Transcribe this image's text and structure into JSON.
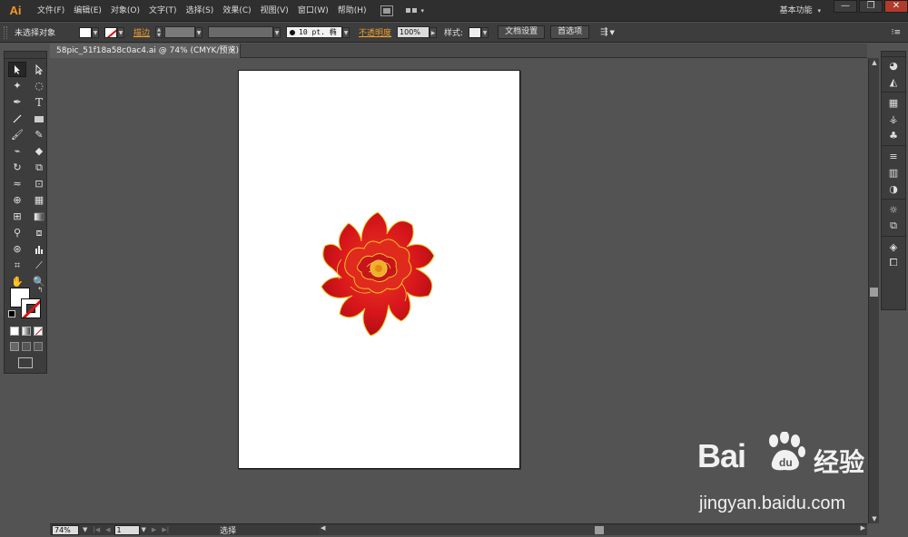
{
  "app": {
    "logo": "Ai"
  },
  "menu": {
    "items": [
      "文件(F)",
      "编辑(E)",
      "对象(O)",
      "文字(T)",
      "选择(S)",
      "效果(C)",
      "视图(V)",
      "窗口(W)",
      "帮助(H)"
    ]
  },
  "workspace": {
    "label": "基本功能",
    "caret": "▾"
  },
  "window_buttons": {
    "minimize": "—",
    "restore": "❐",
    "close": "✕"
  },
  "controlbar": {
    "selection_label": "未选择对象",
    "stroke_label": "描边",
    "stroke_profile": "10 pt. 椭",
    "opacity_label": "不透明度",
    "opacity_value": "100%",
    "style_label": "样式:",
    "doc_setup_button": "文档设置",
    "preferences_button": "首选项"
  },
  "document": {
    "tab_title": "58pic_51f18a58c0ac4.ai @ 74% (CMYK/预览)",
    "close": "×"
  },
  "statusbar": {
    "zoom": "74%",
    "page": "1",
    "status": "选择"
  },
  "watermark": {
    "brand": "Bai",
    "brand_cn": "经验",
    "url": "jingyan.baidu.com"
  },
  "colors": {
    "accent": "#f29a1e",
    "flower_red": "#d7161b",
    "flower_gold": "#f0c020",
    "ui_dark": "#3d3d3d",
    "pasteboard": "#535353"
  },
  "icons": {
    "tools": [
      "selection-tool-icon",
      "direct-selection-tool-icon",
      "magic-wand-icon",
      "lasso-icon",
      "pen-icon",
      "type-icon",
      "line-icon",
      "rectangle-icon",
      "paintbrush-icon",
      "pencil-icon",
      "blob-brush-icon",
      "eraser-icon",
      "rotate-icon",
      "scale-icon",
      "width-icon",
      "free-transform-icon",
      "shape-builder-icon",
      "perspective-grid-icon",
      "mesh-icon",
      "gradient-icon",
      "eyedropper-icon",
      "blend-icon",
      "symbol-sprayer-icon",
      "column-graph-icon",
      "artboard-icon",
      "slice-icon",
      "hand-icon",
      "zoom-icon"
    ]
  }
}
